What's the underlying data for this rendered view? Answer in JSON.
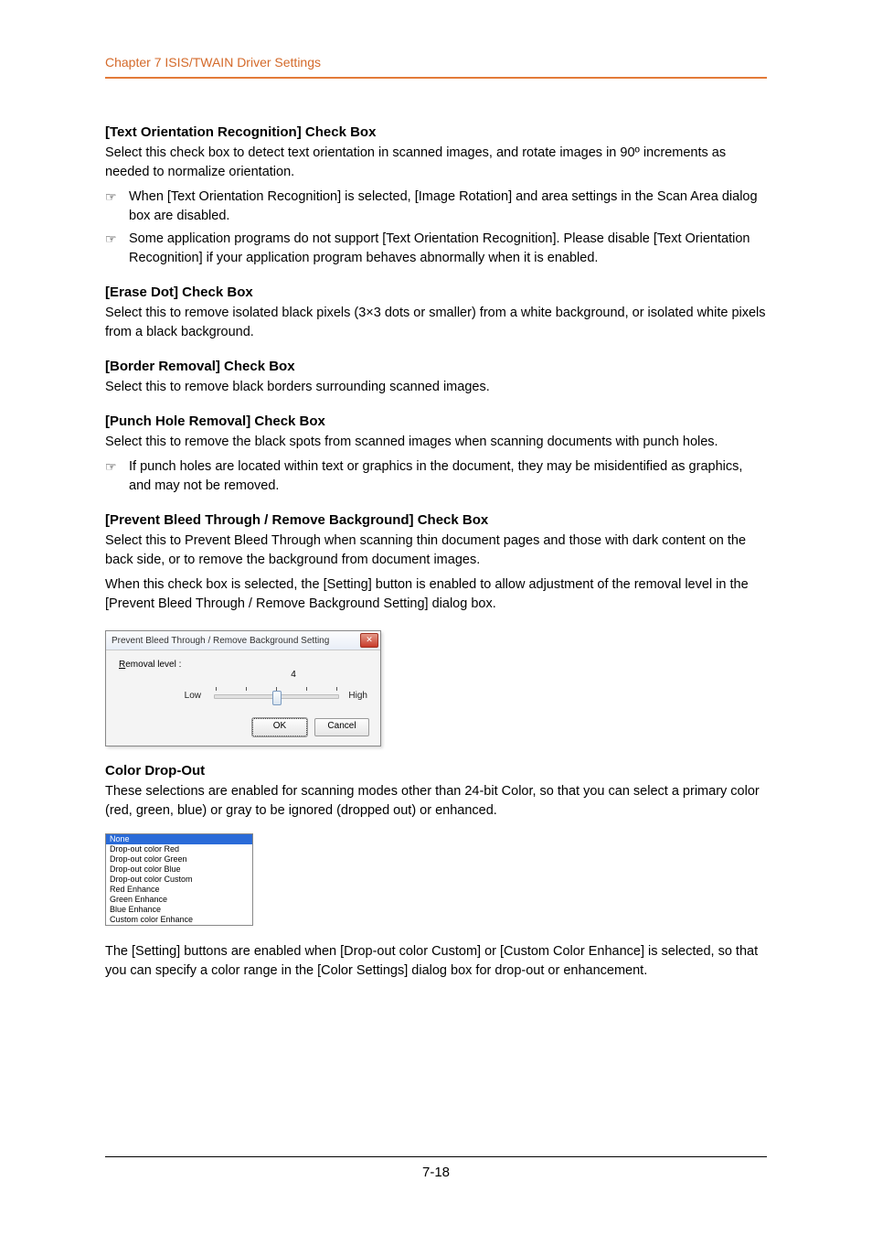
{
  "header": {
    "chapter": "Chapter 7   ISIS/TWAIN Driver Settings"
  },
  "sections": {
    "textOrientation": {
      "title": "[Text Orientation Recognition] Check Box",
      "body": "Select this check box to detect text orientation in scanned images, and rotate images in 90º increments as needed to normalize orientation.",
      "notes": [
        "When [Text Orientation Recognition] is selected, [Image Rotation] and  area settings in the Scan Area dialog box are disabled.",
        "Some application programs do not support [Text Orientation Recognition]. Please disable [Text Orientation Recognition] if your application program behaves abnormally when it is enabled."
      ]
    },
    "eraseDot": {
      "title": "[Erase Dot] Check Box",
      "body": "Select this to remove isolated black pixels (3×3 dots or smaller) from a white background, or isolated white pixels from a black background."
    },
    "borderRemoval": {
      "title": "[Border Removal] Check Box",
      "body": "Select this to remove black borders surrounding scanned images."
    },
    "punchHole": {
      "title": "[Punch Hole Removal] Check Box",
      "body": "Select this to remove the black spots from scanned images when scanning documents with punch holes.",
      "notes": [
        "If punch holes are located within text or graphics in the document, they may be misidentified as graphics, and may not be removed."
      ]
    },
    "preventBleed": {
      "title": "[Prevent Bleed Through / Remove Background] Check Box",
      "body1": "Select this to Prevent Bleed Through when scanning thin document pages and those with dark content on the back side, or to remove the background from document images.",
      "body2": "When this check box is selected, the [Setting] button is enabled to allow adjustment of the removal level in the [Prevent Bleed Through / Remove Background Setting] dialog box."
    },
    "colorDropOut": {
      "title": "Color Drop-Out",
      "body": "These selections are enabled for scanning modes other than 24-bit Color, so that you can select a primary color (red, green, blue) or gray to be ignored (dropped out) or enhanced.",
      "footer": "The [Setting] buttons are enabled when [Drop-out color Custom] or [Custom Color Enhance] is selected, so that you can specify a color range in the [Color Settings] dialog box for drop-out or enhancement."
    }
  },
  "dialog": {
    "title": "Prevent Bleed Through / Remove Background Setting",
    "removalLabelPrefix": "R",
    "removalLabelRest": "emoval level :",
    "value": "4",
    "low": "Low",
    "high": "High",
    "ok": "OK",
    "cancel": "Cancel"
  },
  "dropdown": {
    "items": [
      "None",
      "Drop-out color Red",
      "Drop-out color Green",
      "Drop-out color Blue",
      "Drop-out color Custom",
      "Red Enhance",
      "Green Enhance",
      "Blue Enhance",
      "Custom color Enhance"
    ]
  },
  "pageNumber": "7-18"
}
